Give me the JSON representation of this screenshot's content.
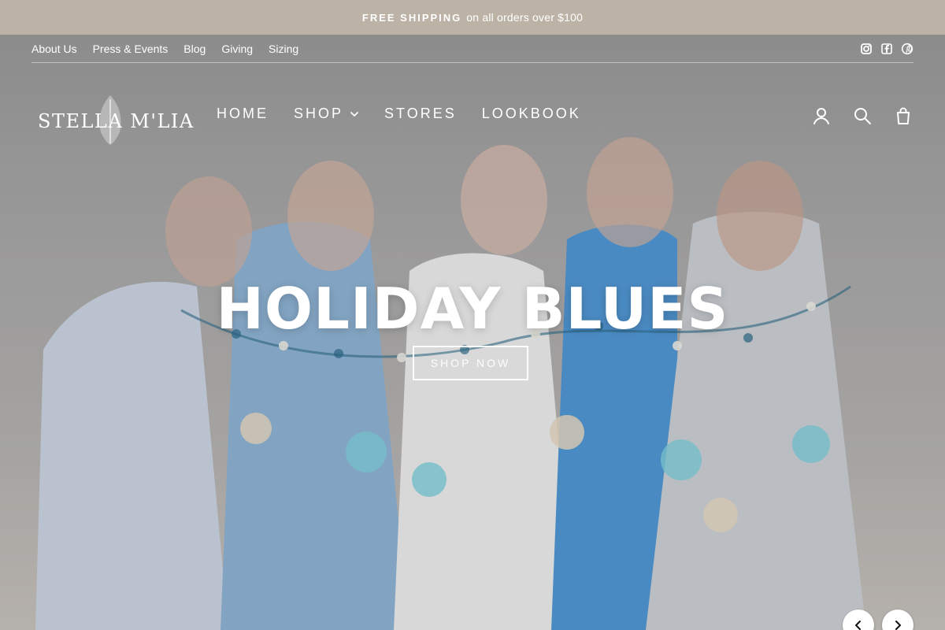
{
  "announcement": {
    "strong": "FREE SHIPPING",
    "text": "on all orders over $100"
  },
  "utility_nav": {
    "links": [
      "About Us",
      "Press & Events",
      "Blog",
      "Giving",
      "Sizing"
    ],
    "social_icons": [
      "instagram-icon",
      "facebook-icon",
      "pinterest-icon"
    ]
  },
  "brand": {
    "logo_text": "STELLA M'LIA"
  },
  "main_nav": {
    "items": [
      "HOME",
      "SHOP",
      "STORES",
      "LOOKBOOK"
    ],
    "icons": [
      "account-icon",
      "search-icon",
      "cart-icon"
    ]
  },
  "hero": {
    "headline": "HOLIDAY BLUES",
    "cta": "SHOP NOW"
  },
  "slider": {
    "prev_icon": "chevron-left-icon",
    "next_icon": "chevron-right-icon"
  },
  "colors": {
    "announcement_bg": "#bdb2a6",
    "text": "#ffffff"
  }
}
